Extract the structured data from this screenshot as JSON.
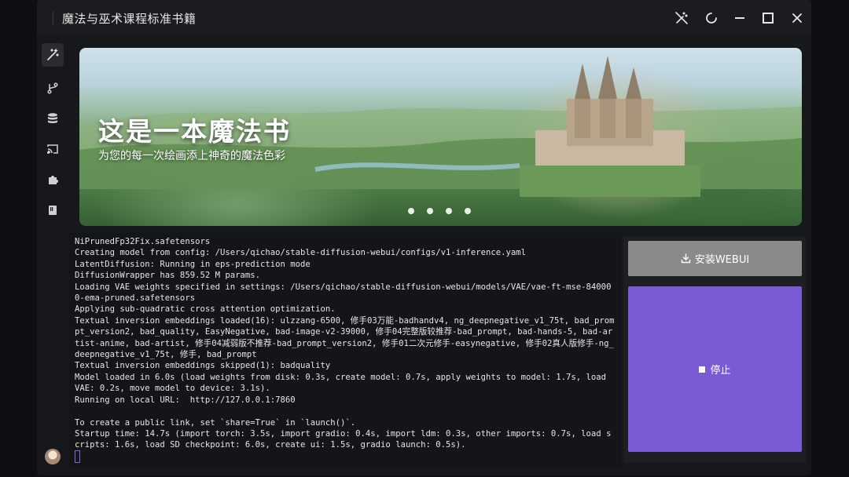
{
  "app": {
    "title": "魔法与巫术课程标准书籍"
  },
  "titlebar": {
    "buttons": [
      "magic-off-icon",
      "refresh-icon",
      "minimize-icon",
      "maximize-icon",
      "close-icon"
    ]
  },
  "sidebar": {
    "items": [
      "magic-wand-icon",
      "branch-icon",
      "database-icon",
      "cast-icon",
      "puzzle-icon",
      "book-icon"
    ],
    "active": 0
  },
  "banner": {
    "title": "这是一本魔法书",
    "subtitle": "为您的每一次绘画添上神奇的魔法色彩",
    "slides": 4
  },
  "console": {
    "lines": [
      "NiPrunedFp32Fix.safetensors",
      "Creating model from config: /Users/qichao/stable-diffusion-webui/configs/v1-inference.yaml",
      "LatentDiffusion: Running in eps-prediction mode",
      "DiffusionWrapper has 859.52 M params.",
      "Loading VAE weights specified in settings: /Users/qichao/stable-diffusion-webui/models/VAE/vae-ft-mse-840000-ema-pruned.safetensors",
      "Applying sub-quadratic cross attention optimization.",
      "Textual inversion embeddings loaded(16): ulzzang-6500, 修手03万能-badhandv4, ng_deepnegative_v1_75t, bad_prompt_version2, bad_quality, EasyNegative, bad-image-v2-39000, 修手04完整版较推荐-bad_prompt, bad-hands-5, bad-artist-anime, bad-artist, 修手04减弱版不推荐-bad_prompt_version2, 修手01二次元修手-easynegative, 修手02真人版修手-ng_deepnegative_v1_75t, 修手, bad_prompt",
      "Textual inversion embeddings skipped(1): badquality",
      "Model loaded in 6.0s (load weights from disk: 0.3s, create model: 0.7s, apply weights to model: 1.7s, load VAE: 0.2s, move model to device: 3.1s).",
      "Running on local URL:  http://127.0.0.1:7860",
      "",
      "To create a public link, set `share=True` in `launch()`.",
      "Startup time: 14.7s (import torch: 3.5s, import gradio: 0.4s, import ldm: 0.3s, other imports: 0.7s, load scripts: 1.6s, load SD checkpoint: 6.0s, create ui: 1.5s, gradio launch: 0.5s)."
    ]
  },
  "actions": {
    "install_label": "安装WEBUI",
    "stop_label": "停止"
  },
  "colors": {
    "stop_button": "#7b5ad6",
    "install_button": "#8a8a8a",
    "background": "#17181b"
  }
}
